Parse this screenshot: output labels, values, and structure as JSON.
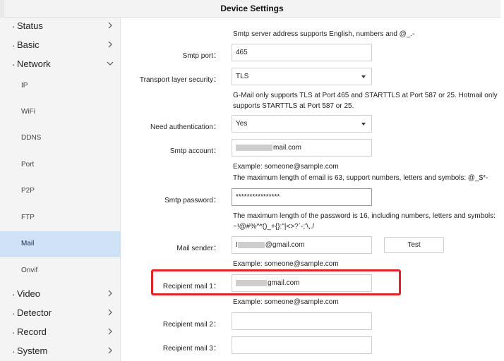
{
  "window": {
    "title": "Device Settings"
  },
  "sidebar": {
    "categories": [
      {
        "label": "Status"
      },
      {
        "label": "Basic"
      },
      {
        "label": "Network"
      },
      {
        "label": "Video"
      },
      {
        "label": "Detector"
      },
      {
        "label": "Record"
      },
      {
        "label": "System"
      }
    ],
    "network_items": [
      {
        "label": "IP"
      },
      {
        "label": "WiFi"
      },
      {
        "label": "DDNS"
      },
      {
        "label": "Port"
      },
      {
        "label": "P2P"
      },
      {
        "label": "FTP"
      },
      {
        "label": "Mail",
        "active": true
      },
      {
        "label": "Onvif"
      }
    ]
  },
  "mail": {
    "server_note": "Smtp server address supports English, numbers and @_.-",
    "smtp_port": {
      "label": "Smtp port：",
      "value": "465"
    },
    "tls": {
      "label": "Transport layer security：",
      "value": "TLS"
    },
    "tls_note": "G-Mail only supports TLS at Port 465 and STARTTLS at Port 587 or 25. Hotmail only supports STARTTLS at Port 587 or 25.",
    "auth": {
      "label": "Need authentication：",
      "value": "Yes"
    },
    "account": {
      "label": "Smtp account：",
      "value_suffix": "mail.com"
    },
    "account_example": "Example: someone@sample.com",
    "account_note": "The maximum length of email is 63, support numbers, letters and symbols: @_$*-",
    "password": {
      "label": "Smtp password：",
      "value": "****************"
    },
    "password_note": "The maximum length of the password is 16, including numbers, letters and symbols: ~!@#%^*()_+{}:\"|<>?`-;'\\,./",
    "sender": {
      "label": "Mail sender：",
      "value_prefix": "I",
      "value_suffix": "@gmail.com"
    },
    "test_button": "Test",
    "sender_example": "Example: someone@sample.com",
    "recipient1": {
      "label": "Recipient mail 1：",
      "value_suffix": "gmail.com"
    },
    "recipient1_example": "Example: someone@sample.com",
    "recipient2": {
      "label": "Recipient mail 2：",
      "value": ""
    },
    "recipient3": {
      "label": "Recipient mail 3：",
      "value": ""
    }
  },
  "colors": {
    "highlight": "#e0242a",
    "active_item_bg": "#cfe2f5"
  }
}
